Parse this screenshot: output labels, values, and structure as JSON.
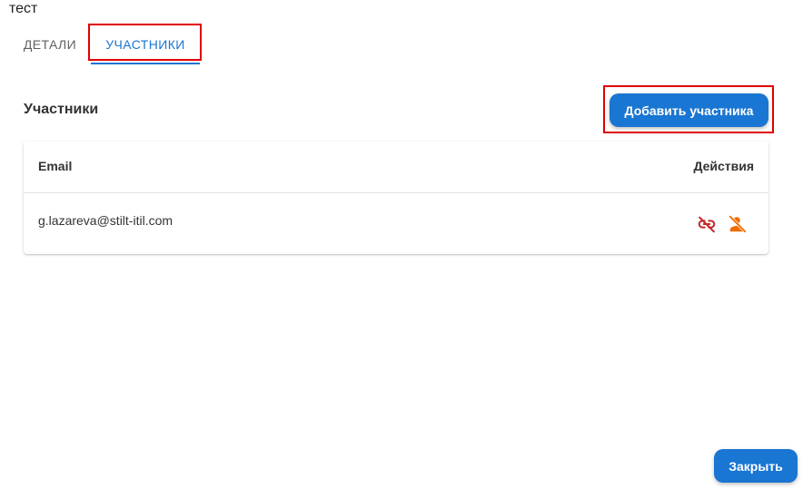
{
  "dialog": {
    "title": "тест"
  },
  "tabs": [
    {
      "label": "ДЕТАЛИ",
      "active": false
    },
    {
      "label": "УЧАСТНИКИ",
      "active": true
    }
  ],
  "section": {
    "title": "Участники",
    "add_button_label": "Добавить участника"
  },
  "table": {
    "headers": {
      "email": "Email",
      "actions": "Действия"
    },
    "rows": [
      {
        "email": "g.lazareva@stilt-itil.com",
        "actions": [
          "link-off-icon",
          "person-off-icon"
        ]
      }
    ]
  },
  "footer": {
    "close_label": "Закрыть"
  },
  "colors": {
    "primary": "#1976d2",
    "highlight": "#e00000",
    "unlink_icon": "#c62828",
    "remove_icon": "#ef6c00"
  }
}
